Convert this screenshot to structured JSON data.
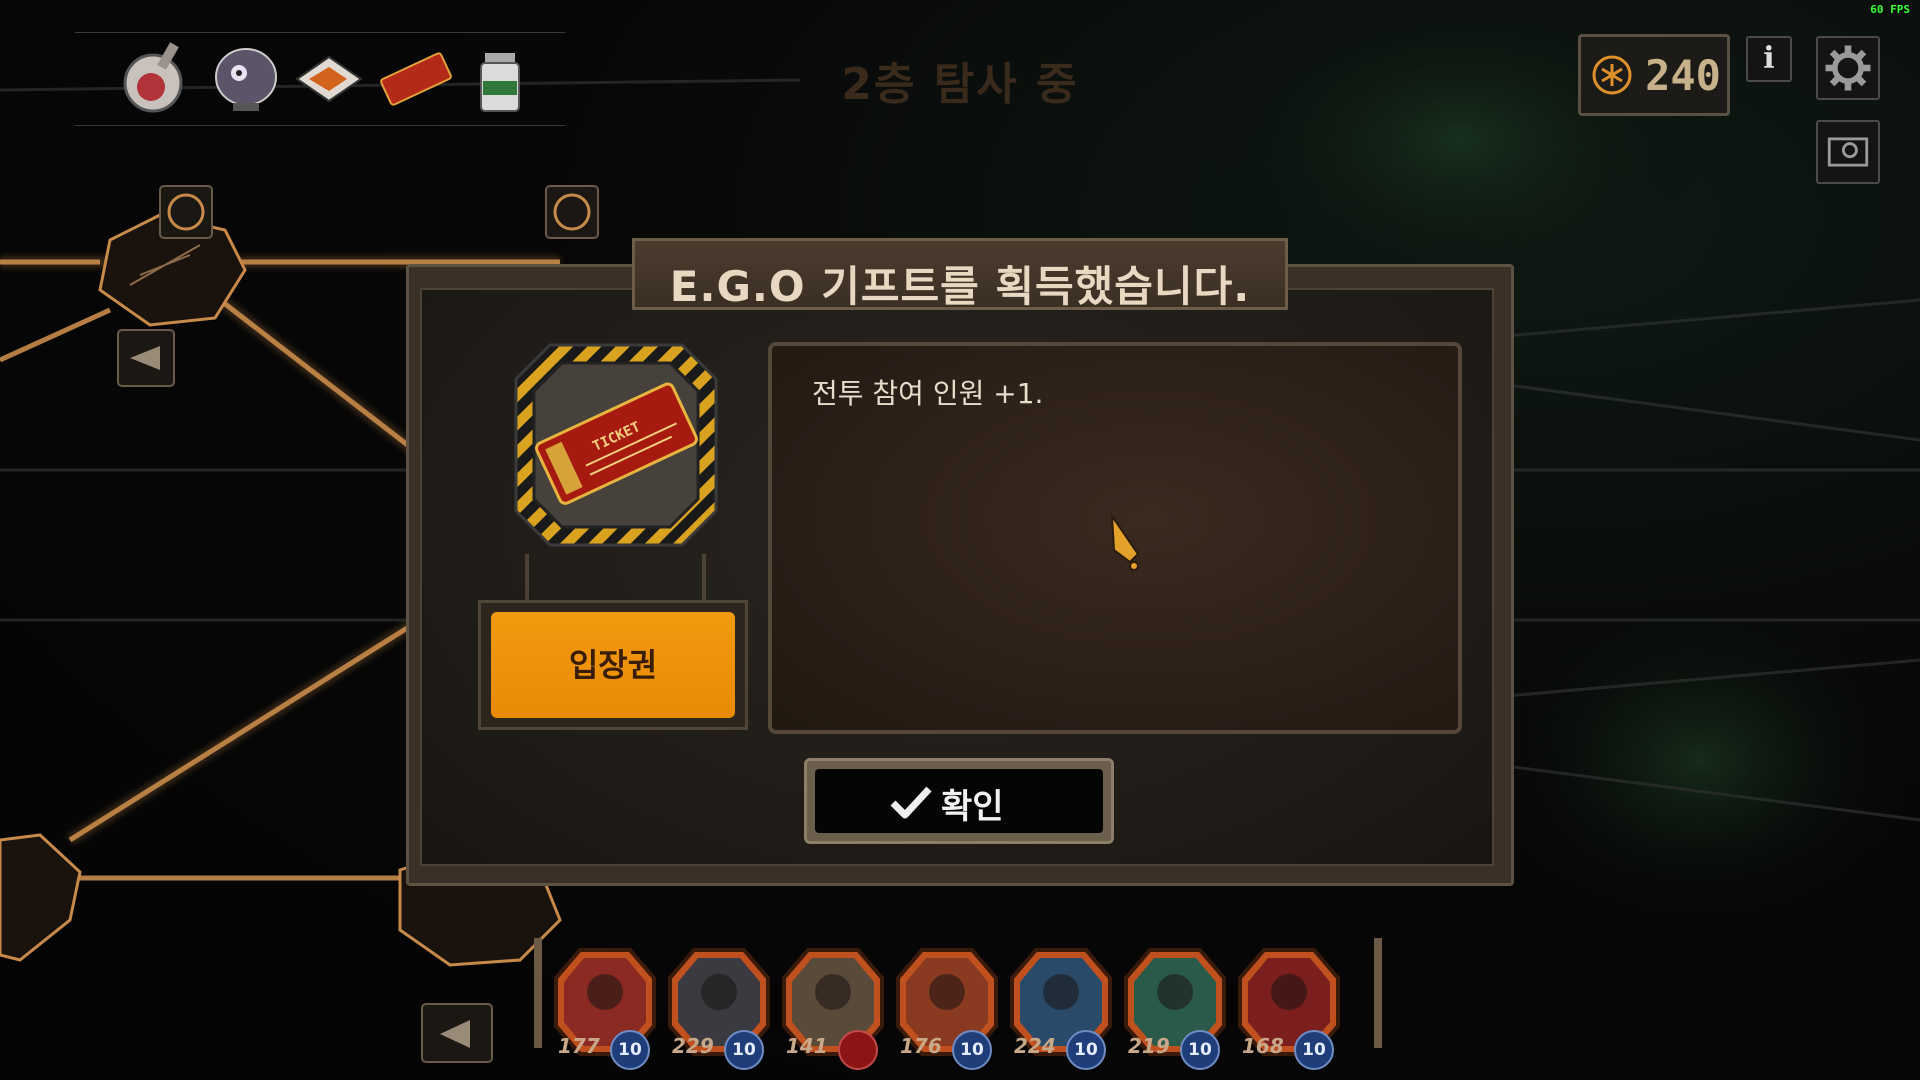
{
  "hud": {
    "fps": "60 FPS",
    "floor_status": "2층 탐사 중",
    "currency_value": "240",
    "currency_icon": "cost-star-icon",
    "info_label": "i"
  },
  "gifts_bar": [
    {
      "icon": "apple-flask-gift-icon"
    },
    {
      "icon": "eye-orb-gift-icon"
    },
    {
      "icon": "cigarette-pack-gift-icon"
    },
    {
      "icon": "ticket-gift-icon"
    },
    {
      "icon": "pill-bottle-gift-icon"
    }
  ],
  "dialog": {
    "title": "E.G.O 기프트를 획득했습니다.",
    "gift_name": "입장권",
    "gift_icon": "ticket-gift-icon",
    "description": "전투 참여 인원 +1.",
    "confirm_label": "확인"
  },
  "party": [
    {
      "hp": "177",
      "level": "10",
      "badge_color": "blue"
    },
    {
      "hp": "229",
      "level": "10",
      "badge_color": "blue"
    },
    {
      "hp": "141",
      "level": "",
      "badge_color": "red"
    },
    {
      "hp": "176",
      "level": "10",
      "badge_color": "blue"
    },
    {
      "hp": "224",
      "level": "10",
      "badge_color": "blue"
    },
    {
      "hp": "219",
      "level": "10",
      "badge_color": "blue"
    },
    {
      "hp": "168",
      "level": "10",
      "badge_color": "blue"
    }
  ],
  "colors": {
    "accent_orange": "#e88a05",
    "node_glow": "#c88a4a",
    "frame": "#5e5242"
  }
}
